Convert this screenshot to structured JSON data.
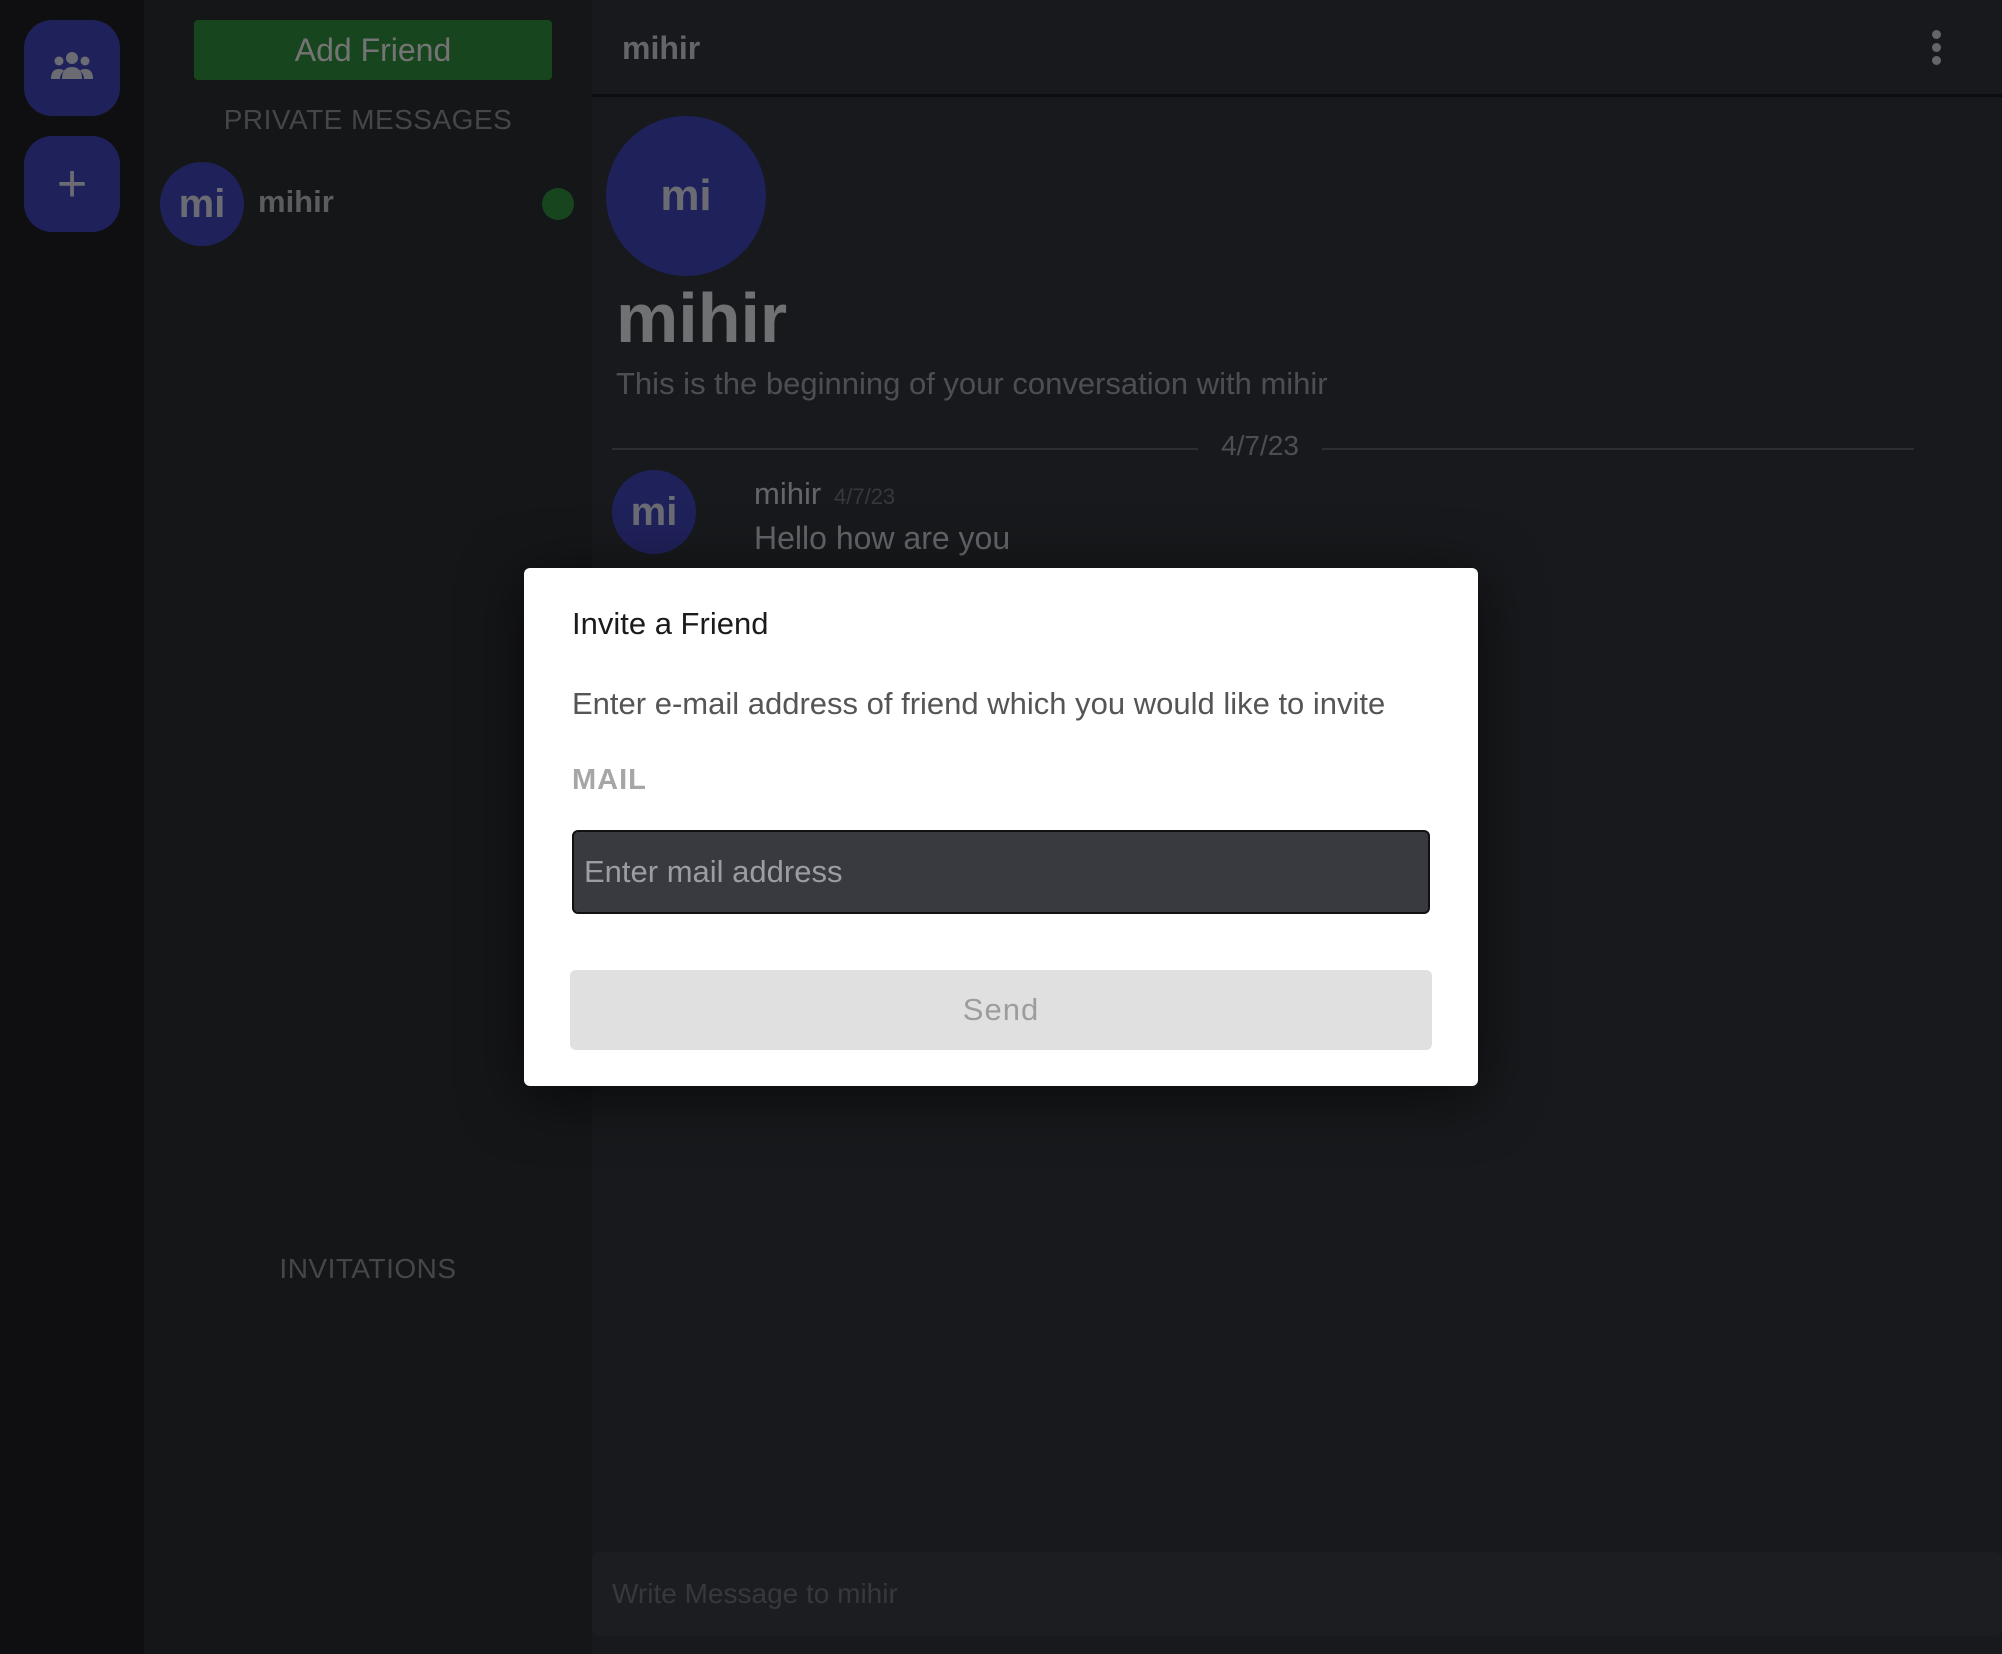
{
  "rail": {
    "friends_icon": "people-group-icon",
    "add_label": "+"
  },
  "sidebar": {
    "add_friend_label": "Add Friend",
    "private_messages_title": "PRIVATE MESSAGES",
    "invitations_title": "INVITATIONS",
    "conversations": [
      {
        "avatar_initials": "mi",
        "name": "mihir",
        "status": "online"
      }
    ]
  },
  "chat": {
    "header_name": "mihir",
    "intro": {
      "avatar_initials": "mi",
      "name": "mihir",
      "text": "This is the beginning of your conversation with mihir"
    },
    "date_divider": "4/7/23",
    "messages": [
      {
        "avatar_initials": "mi",
        "author": "mihir",
        "time": "4/7/23",
        "text": "Hello how are you"
      }
    ],
    "composer_placeholder": "Write Message to mihir"
  },
  "modal": {
    "title": "Invite a Friend",
    "description": "Enter e-mail address of friend which you would like to invite",
    "mail_label": "MAIL",
    "mail_placeholder": "Enter mail address",
    "mail_value": "",
    "send_label": "Send"
  },
  "colors": {
    "accent": "#3f43b5",
    "success": "#2f8a3c",
    "background": "#313338",
    "sidebar": "#2b2d31"
  }
}
